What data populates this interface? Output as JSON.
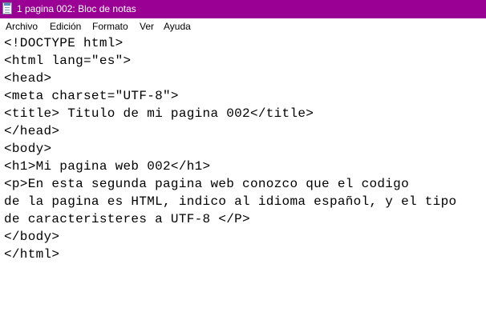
{
  "window": {
    "title": "1 pagina 002: Bloc de notas",
    "icon": "notepad-icon",
    "titlebar_color": "#9a0094"
  },
  "menu": {
    "archivo": "Archivo",
    "edicion": "Edición",
    "formato": "Formato",
    "ver": "Ver",
    "ayuda": "Ayuda"
  },
  "editor": {
    "lines": [
      "<!DOCTYPE html>",
      "<html lang=\"es\">",
      "<head>",
      "<meta charset=\"UTF-8\">",
      "<title> Titulo de mi pagina 002</title>",
      "</head>",
      "<body>",
      "<h1>Mi pagina web 002</h1>",
      "<p>En esta segunda pagina web conozco que el codigo",
      "de la pagina es HTML, indico al idioma español, y el tipo",
      "de caracteristeres a UTF-8 </P>",
      "</body>",
      "</html>"
    ]
  }
}
